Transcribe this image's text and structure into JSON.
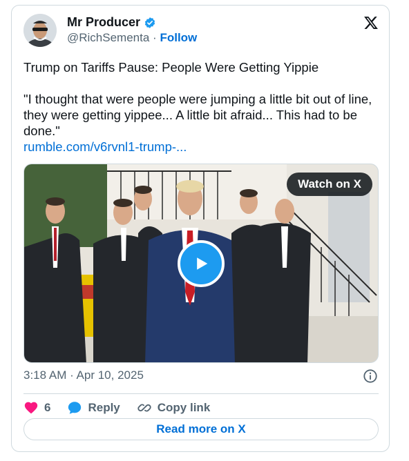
{
  "author": {
    "display_name": "Mr Producer",
    "handle": "@RichSementa",
    "separator": "·",
    "follow_label": "Follow",
    "verified": true
  },
  "tweet": {
    "headline": "Trump on Tariffs Pause: People Were Getting Yippie",
    "quote": "\"I thought that were people were jumping a little bit out of line, they were getting yippee... A little bit afraid... This had to be done.\"",
    "link_text": "rumble.com/v6rvnl1-trump-..."
  },
  "media": {
    "watch_label": "Watch on X",
    "play_icon": "play-icon"
  },
  "meta": {
    "timestamp": "3:18 AM · Apr 10, 2025"
  },
  "actions": {
    "like_count": "6",
    "reply_label": "Reply",
    "copy_label": "Copy link"
  },
  "footer": {
    "read_more_label": "Read more on X"
  },
  "colors": {
    "accent": "#006fd6",
    "play_button": "#1d9bf0",
    "like": "#f91880",
    "verified": "#1d9bf0",
    "muted_text": "#536471",
    "border": "#cfd9de"
  }
}
